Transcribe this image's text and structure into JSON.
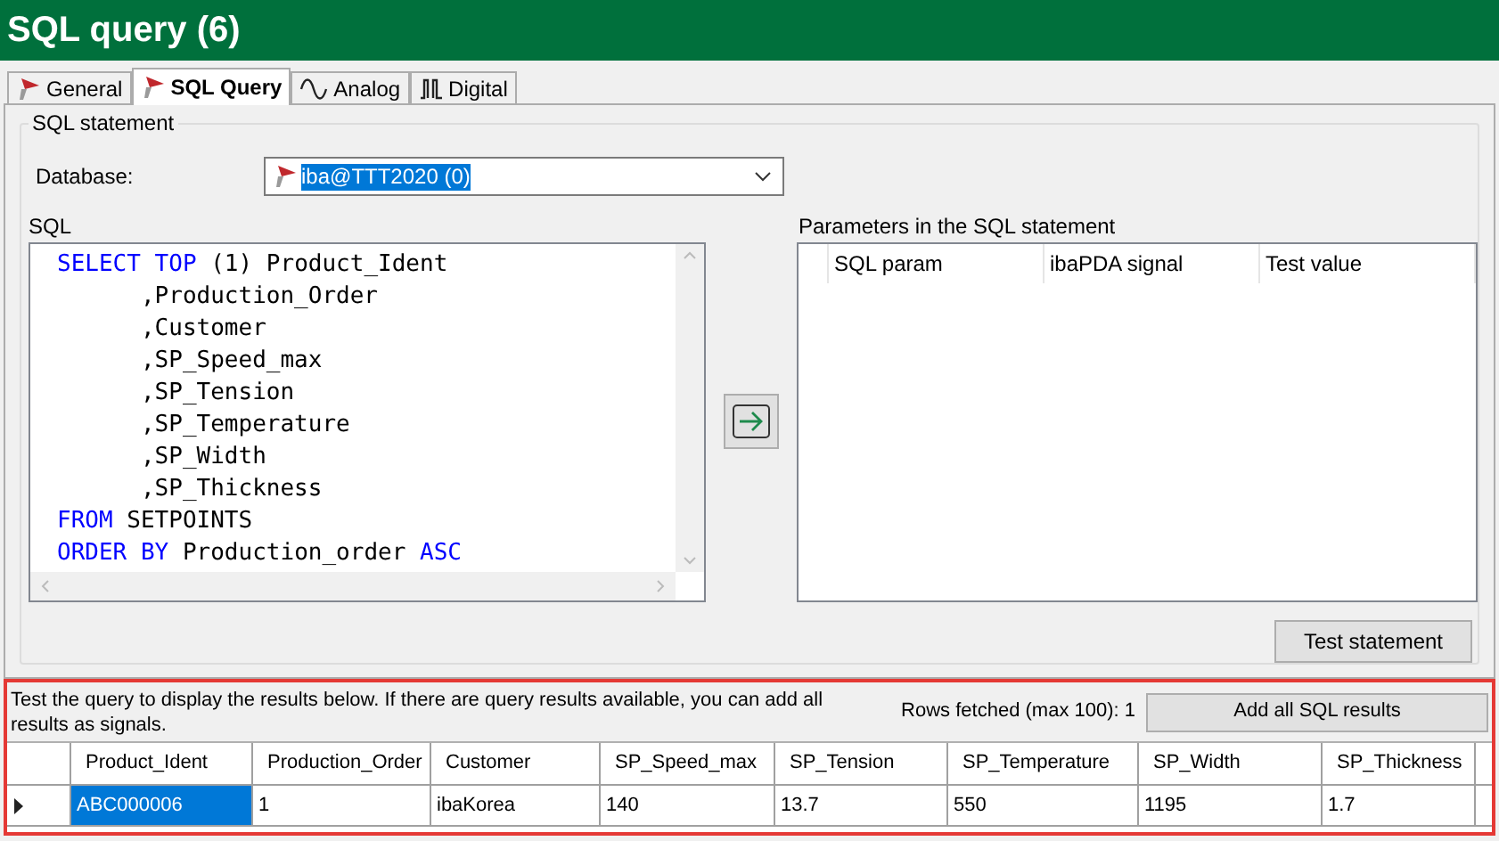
{
  "window": {
    "title": "SQL query (6)"
  },
  "tabs": [
    {
      "label": "General",
      "kind": "iba",
      "selected": false
    },
    {
      "label": "SQL Query",
      "kind": "iba",
      "selected": true
    },
    {
      "label": "Analog",
      "kind": "wave",
      "selected": false
    },
    {
      "label": "Digital",
      "kind": "pulse",
      "selected": false
    }
  ],
  "sql_statement": {
    "title": "SQL statement",
    "database_label": "Database:",
    "database_value": "iba@TTT2020 (0)",
    "sql_label": "SQL",
    "sql_lines": [
      [
        {
          "text": "SELECT TOP",
          "kind": "keyword"
        },
        {
          "text": " (1) Product_Ident",
          "kind": "plain"
        }
      ],
      [
        {
          "text": "      ,Production_Order",
          "kind": "plain"
        }
      ],
      [
        {
          "text": "      ,Customer",
          "kind": "plain"
        }
      ],
      [
        {
          "text": "      ,SP_Speed_max",
          "kind": "plain"
        }
      ],
      [
        {
          "text": "      ,SP_Tension",
          "kind": "plain"
        }
      ],
      [
        {
          "text": "      ,SP_Temperature",
          "kind": "plain"
        }
      ],
      [
        {
          "text": "      ,SP_Width",
          "kind": "plain"
        }
      ],
      [
        {
          "text": "      ,SP_Thickness",
          "kind": "plain"
        }
      ],
      [
        {
          "text": "FROM",
          "kind": "keyword"
        },
        {
          "text": " SETPOINTS",
          "kind": "plain"
        }
      ],
      [
        {
          "text": "ORDER BY",
          "kind": "keyword"
        },
        {
          "text": " Production_order ",
          "kind": "plain"
        },
        {
          "text": "ASC",
          "kind": "keyword"
        }
      ]
    ],
    "parameters_label": "Parameters in the SQL statement",
    "parameter_columns": [
      "SQL param",
      "ibaPDA signal",
      "Test value"
    ],
    "test_button": "Test statement"
  },
  "results": {
    "hint": "Test the query to display the results below. If there are query results available, you can add all results as signals.",
    "rows_fetched": "Rows fetched (max 100): 1",
    "add_button": "Add all SQL results",
    "columns": [
      "Product_Ident",
      "Production_Order",
      "Customer",
      "SP_Speed_max",
      "SP_Tension",
      "SP_Temperature",
      "SP_Width",
      "SP_Thickness"
    ],
    "rows": [
      {
        "current": true,
        "cells": [
          {
            "text": "ABC000006",
            "selected": true
          },
          {
            "text": "1",
            "selected": false
          },
          {
            "text": "ibaKorea",
            "selected": false
          },
          {
            "text": "140",
            "selected": false
          },
          {
            "text": "13.7",
            "selected": false
          },
          {
            "text": "550",
            "selected": false
          },
          {
            "text": "1195",
            "selected": false
          },
          {
            "text": "1.7",
            "selected": false
          }
        ]
      }
    ]
  }
}
